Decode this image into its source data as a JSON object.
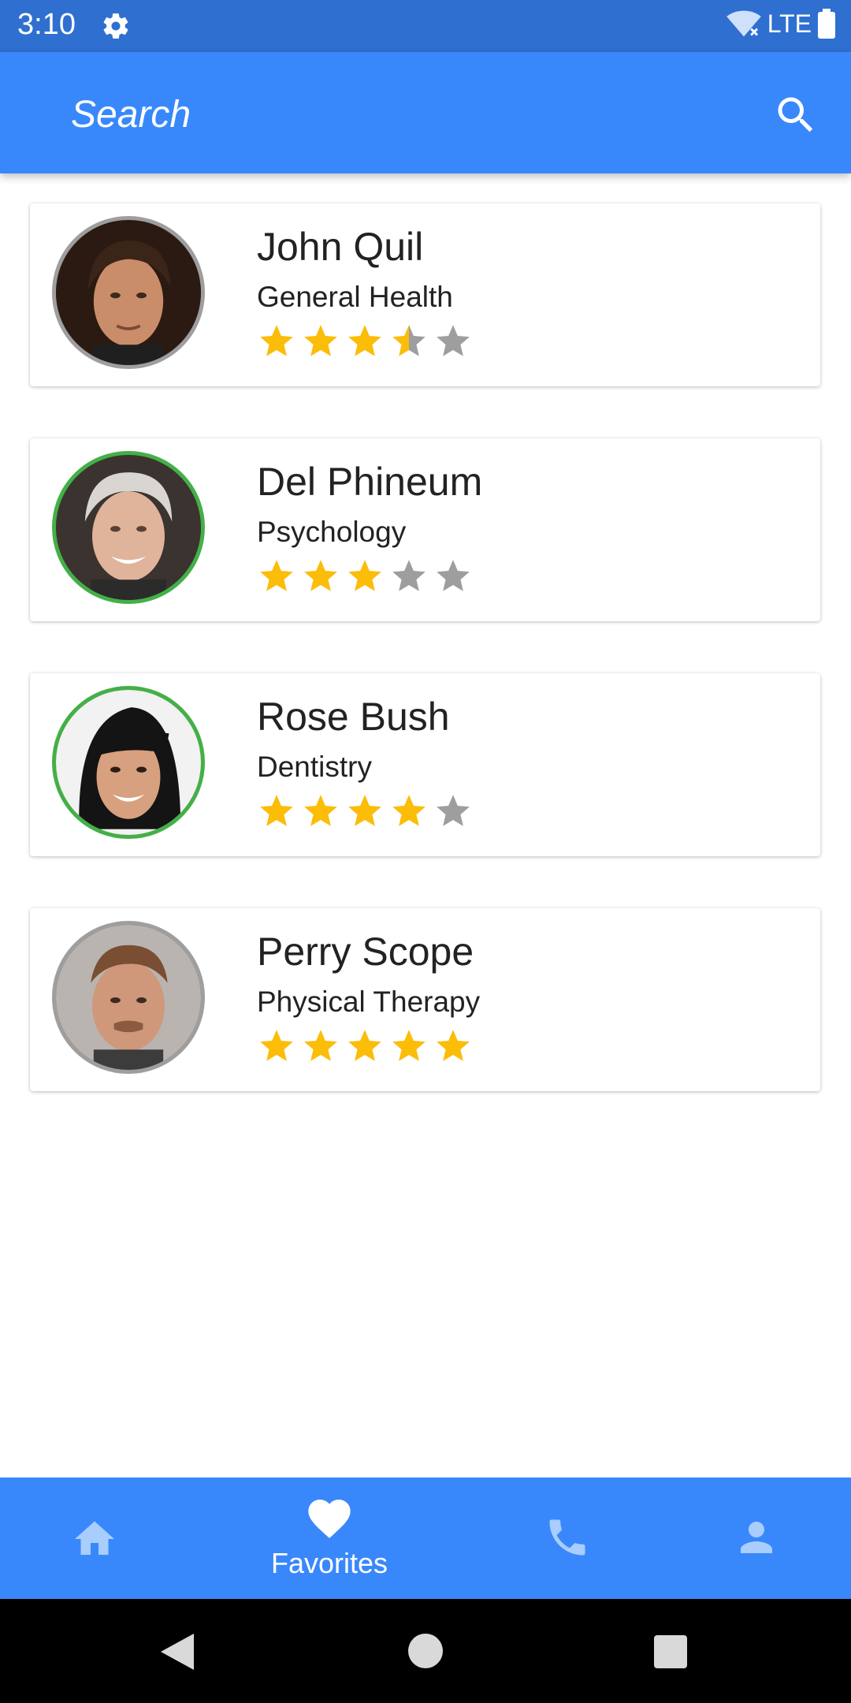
{
  "status_bar": {
    "time": "3:10",
    "network": "LTE",
    "icons": [
      "gear-icon",
      "wifi-off-icon",
      "battery-icon"
    ]
  },
  "search": {
    "placeholder": "Search",
    "icon": "search-icon"
  },
  "doctors": [
    {
      "name": "John Quil",
      "specialty": "General Health",
      "rating": 3.5,
      "max_rating": 5,
      "online": false
    },
    {
      "name": "Del Phineum",
      "specialty": "Psychology",
      "rating": 3,
      "max_rating": 5,
      "online": true
    },
    {
      "name": "Rose Bush",
      "specialty": "Dentistry",
      "rating": 4,
      "max_rating": 5,
      "online": true
    },
    {
      "name": "Perry Scope",
      "specialty": "Physical Therapy",
      "rating": 5,
      "max_rating": 5,
      "online": false
    }
  ],
  "bottom_nav": {
    "items": [
      {
        "icon": "home-icon",
        "label": "",
        "active": false
      },
      {
        "icon": "heart-icon",
        "label": "Favorites",
        "active": true
      },
      {
        "icon": "phone-icon",
        "label": "",
        "active": false
      },
      {
        "icon": "person-icon",
        "label": "",
        "active": false
      }
    ]
  },
  "colors": {
    "status_bar": "#2f6fd0",
    "primary": "#3988fb",
    "star_filled": "#fbbd08",
    "star_empty": "#9e9e9e",
    "online_ring": "#43b047",
    "offline_ring": "#9e9e9e",
    "inactive_nav_icon": "#a9cdfd"
  }
}
